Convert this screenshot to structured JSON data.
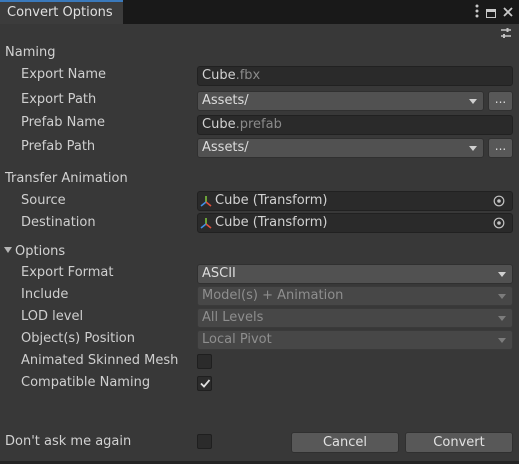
{
  "window": {
    "title": "Convert Options",
    "menu_icon": "kebab-menu-icon",
    "maximize_icon": "maximize-icon",
    "close_icon": "close-icon",
    "settings_icon": "preset-settings-icon"
  },
  "naming": {
    "section_title": "Naming",
    "export_name_label": "Export Name",
    "export_name_value": "Cube",
    "export_name_ext": ".fbx",
    "export_path_label": "Export Path",
    "export_path_value": "Assets/",
    "browse_label": "...",
    "prefab_name_label": "Prefab Name",
    "prefab_name_value": "Cube",
    "prefab_name_ext": ".prefab",
    "prefab_path_label": "Prefab Path",
    "prefab_path_value": "Assets/"
  },
  "transfer": {
    "section_title": "Transfer Animation",
    "source_label": "Source",
    "source_value": "Cube (Transform)",
    "destination_label": "Destination",
    "destination_value": "Cube (Transform)",
    "object_icon": "transform-icon"
  },
  "options": {
    "section_title": "Options",
    "expanded": true,
    "export_format_label": "Export Format",
    "export_format_value": "ASCII",
    "include_label": "Include",
    "include_value": "Model(s) + Animation",
    "lod_label": "LOD level",
    "lod_value": "All Levels",
    "position_label": "Object(s) Position",
    "position_value": "Local Pivot",
    "skinned_label": "Animated Skinned Mesh",
    "skinned_checked": false,
    "naming_label": "Compatible Naming",
    "naming_checked": true
  },
  "footer": {
    "dont_ask_label": "Don't ask me again",
    "dont_ask_checked": false,
    "cancel_label": "Cancel",
    "convert_label": "Convert"
  }
}
